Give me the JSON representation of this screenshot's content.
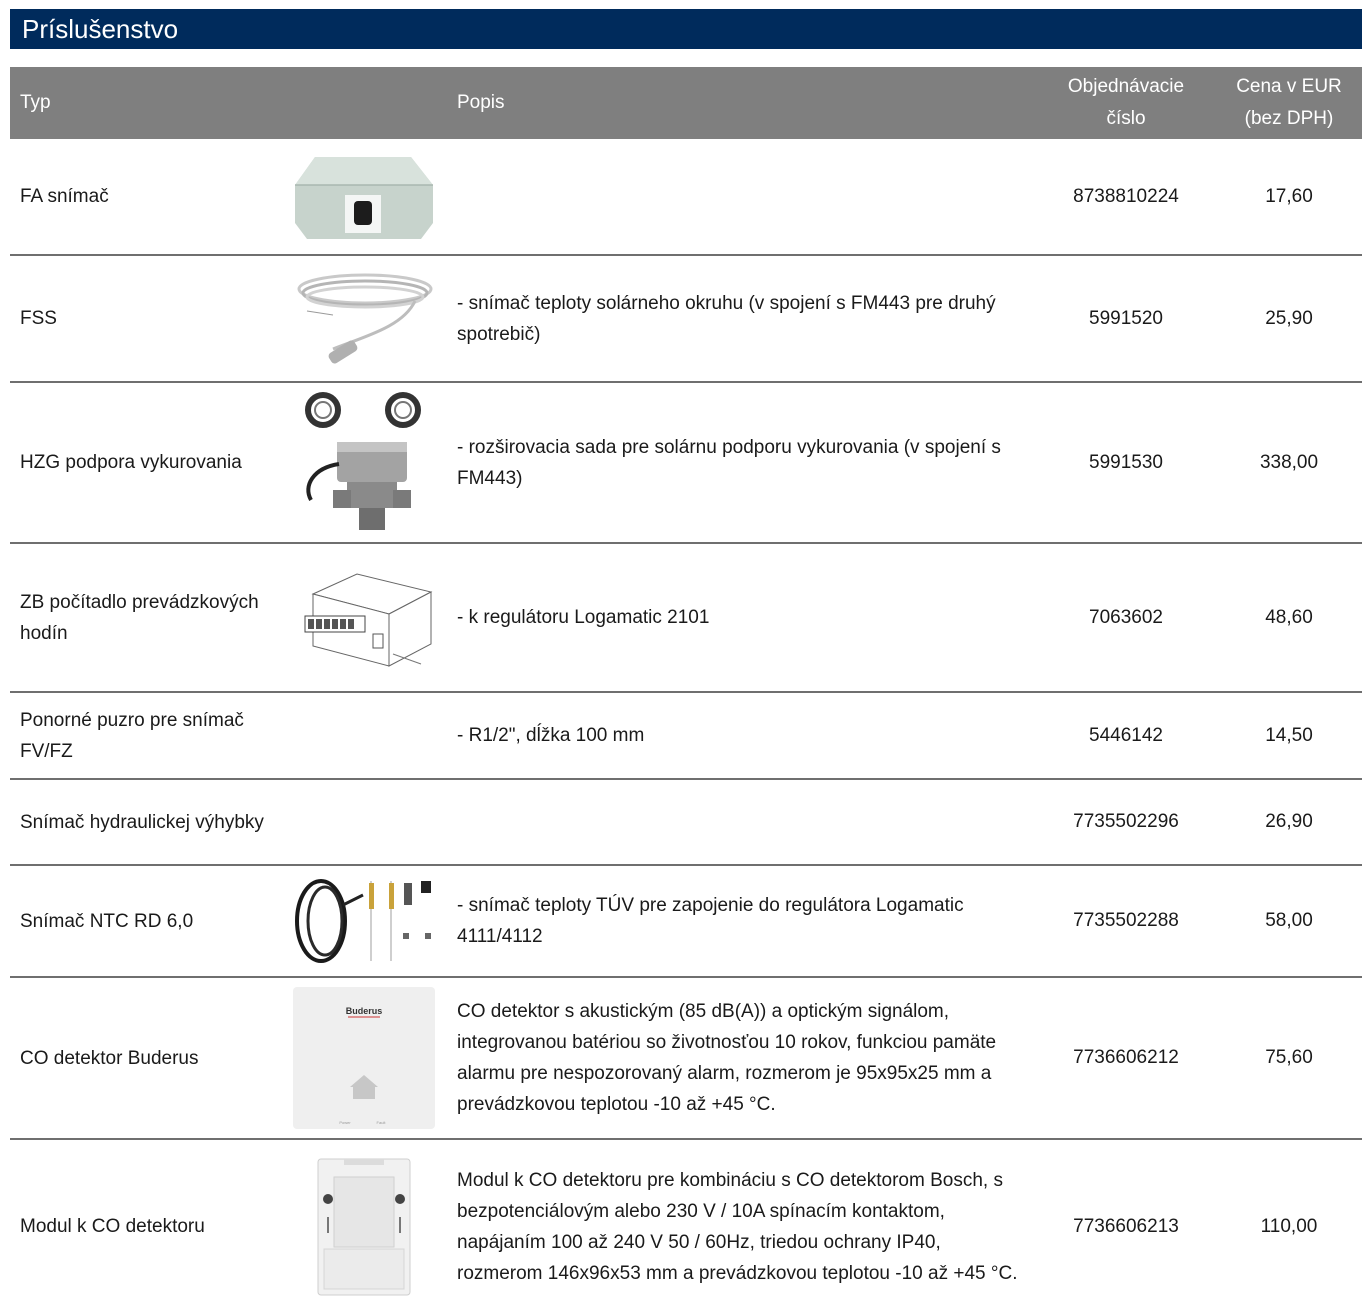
{
  "section": {
    "title": "Príslušenstvo"
  },
  "header": {
    "type": "Typ",
    "description": "Popis",
    "order_number": "Objednávacie číslo",
    "price": "Cena v EUR (bez DPH)"
  },
  "colors": {
    "section_bar": "#002b5c",
    "header_bg": "#7f7f7f",
    "divider": "#6f6f6f"
  },
  "rows": [
    {
      "type": "FA snímač",
      "image": "fa-sensor-image",
      "description": "",
      "order": "8738810224",
      "price": "17,60"
    },
    {
      "type": "FSS",
      "image": "fss-cable-sensor-image",
      "description": "- snímač teploty solárneho okruhu (v spojení s FM443 pre druhý spotrebič)",
      "order": "5991520",
      "price": "25,90"
    },
    {
      "type": "HZG podpora vykurovania",
      "image": "hzg-valve-image",
      "description": "- rozširovacia sada pre solárnu podporu vykurovania (v spojení s FM443)",
      "order": "5991530",
      "price": "338,00"
    },
    {
      "type": "ZB počítadlo prevádzkových hodín",
      "image": "hour-counter-image",
      "description": "- k regulátoru Logamatic 2101",
      "order": "7063602",
      "price": "48,60"
    },
    {
      "type": "Ponorné puzro pre snímač FV/FZ",
      "image": "",
      "description": "- R1/2\", dĺžka 100 mm",
      "order": "5446142",
      "price": "14,50"
    },
    {
      "type": "Snímač hydraulickej výhybky",
      "image": "",
      "description": "",
      "order": "7735502296",
      "price": "26,90"
    },
    {
      "type": "Snímač NTC RD 6,0",
      "image": "ntc-sensor-image",
      "description": "- snímač teploty TÚV pre zapojenie do regulátora Logamatic 4111/4112",
      "order": "7735502288",
      "price": "58,00"
    },
    {
      "type": "CO detektor Buderus",
      "image": "co-detector-image",
      "image_brand": "Buderus",
      "image_labels": [
        "Power",
        "Fault"
      ],
      "description": "CO detektor s akustickým (85 dB(A)) a optickým signálom, integrovanou batériou so životnosťou 10 rokov, funkciou pamäte alarmu pre nespozorovaný alarm, rozmerom je 95x95x25 mm a prevádzkovou teplotou -10 až +45 °C.",
      "order": "7736606212",
      "price": "75,60"
    },
    {
      "type": "Modul k CO detektoru",
      "image": "co-module-image",
      "description": "Modul k CO detektoru pre kombináciu s CO detektorom Bosch, s bezpotenciálovým alebo 230 V / 10A spínacím kontaktom, napájaním 100 až 240 V 50 / 60Hz, triedou ochrany IP40, rozmerom 146x96x53 mm a prevádzkovou teplotou -10 až +45 °C.",
      "order": "7736606213",
      "price": "110,00"
    }
  ]
}
